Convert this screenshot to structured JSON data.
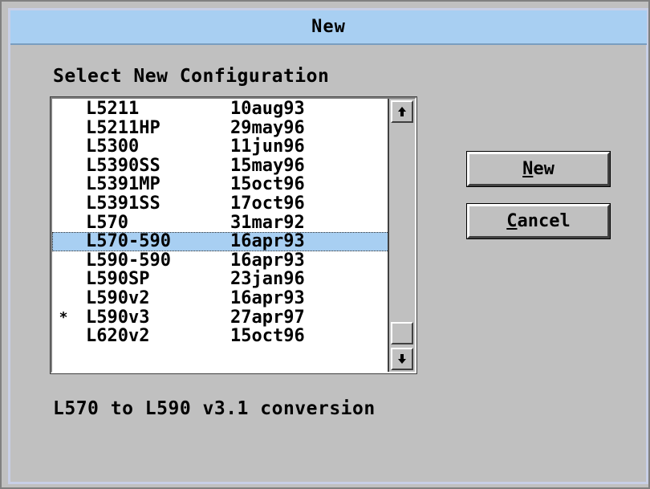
{
  "dialog": {
    "title": "New",
    "prompt": "Select New Configuration",
    "status_text": "L570 to L590 v3.1 conversion"
  },
  "list": {
    "items": [
      {
        "marker": "",
        "name": "L5211",
        "date": "10aug93",
        "selected": false
      },
      {
        "marker": "",
        "name": "L5211HP",
        "date": "29may96",
        "selected": false
      },
      {
        "marker": "",
        "name": "L5300",
        "date": "11jun96",
        "selected": false
      },
      {
        "marker": "",
        "name": "L5390SS",
        "date": "15may96",
        "selected": false
      },
      {
        "marker": "",
        "name": "L5391MP",
        "date": "15oct96",
        "selected": false
      },
      {
        "marker": "",
        "name": "L5391SS",
        "date": "17oct96",
        "selected": false
      },
      {
        "marker": "",
        "name": "L570",
        "date": "31mar92",
        "selected": false
      },
      {
        "marker": "",
        "name": "L570-590",
        "date": "16apr93",
        "selected": true
      },
      {
        "marker": "",
        "name": "L590-590",
        "date": "16apr93",
        "selected": false
      },
      {
        "marker": "",
        "name": "L590SP",
        "date": "23jan96",
        "selected": false
      },
      {
        "marker": "",
        "name": "L590v2",
        "date": "16apr93",
        "selected": false
      },
      {
        "marker": "*",
        "name": "L590v3",
        "date": "27apr97",
        "selected": false
      },
      {
        "marker": "",
        "name": "L620v2",
        "date": "15oct96",
        "selected": false
      }
    ],
    "scroll_up_icon": "arrow-up-icon",
    "scroll_down_icon": "arrow-down-icon"
  },
  "buttons": {
    "new": {
      "mnemonic": "N",
      "rest": "ew"
    },
    "cancel": {
      "mnemonic": "C",
      "rest": "ancel"
    }
  }
}
